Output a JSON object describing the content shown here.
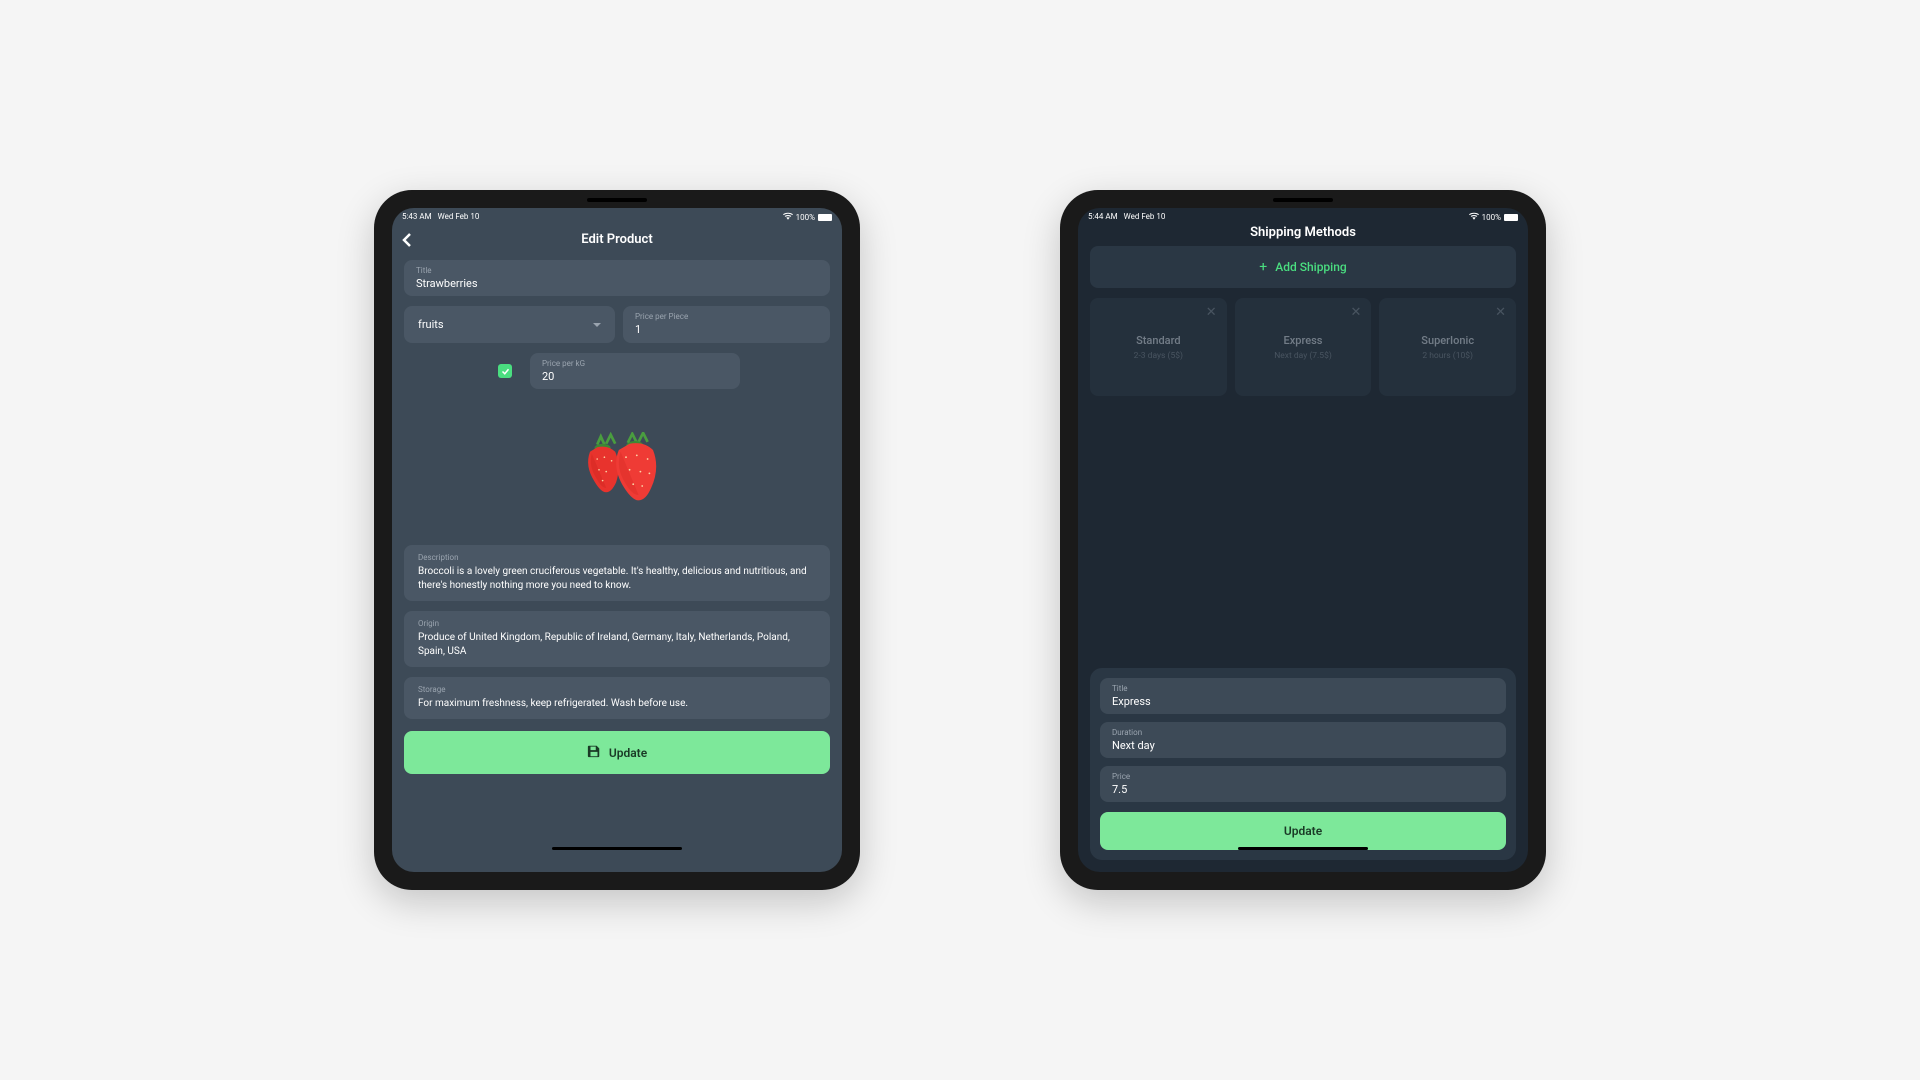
{
  "left": {
    "status": {
      "time": "5:43 AM",
      "date": "Wed Feb 10",
      "battery": "100%"
    },
    "header": {
      "title": "Edit Product"
    },
    "fields": {
      "title_label": "Title",
      "title_value": "Strawberries",
      "category_value": "fruits",
      "price_piece_label": "Price per Piece",
      "price_piece_value": "1",
      "price_kg_label": "Price per kG",
      "price_kg_value": "20",
      "description_label": "Description",
      "description_value": "Broccoli is a lovely green cruciferous vegetable. It's healthy, delicious and nutritious, and there's honestly nothing more you need to know.",
      "origin_label": "Origin",
      "origin_value": "Produce of United Kingdom, Republic of Ireland, Germany, Italy, Netherlands, Poland, Spain, USA",
      "storage_label": "Storage",
      "storage_value": "For maximum freshness, keep refrigerated. Wash before use."
    },
    "update_button": "Update"
  },
  "right": {
    "status": {
      "time": "5:44 AM",
      "date": "Wed Feb 10",
      "battery": "100%"
    },
    "header": {
      "title": "Shipping Methods"
    },
    "add_button": "Add Shipping",
    "cards": [
      {
        "title": "Standard",
        "subtitle": "2-3 days (5$)"
      },
      {
        "title": "Express",
        "subtitle": "Next day (7.5$)"
      },
      {
        "title": "SuperIonic",
        "subtitle": "2 hours (10$)"
      }
    ],
    "sheet": {
      "title_label": "Title",
      "title_value": "Express",
      "duration_label": "Duration",
      "duration_value": "Next day",
      "price_label": "Price",
      "price_value": "7.5"
    },
    "update_button": "Update"
  }
}
